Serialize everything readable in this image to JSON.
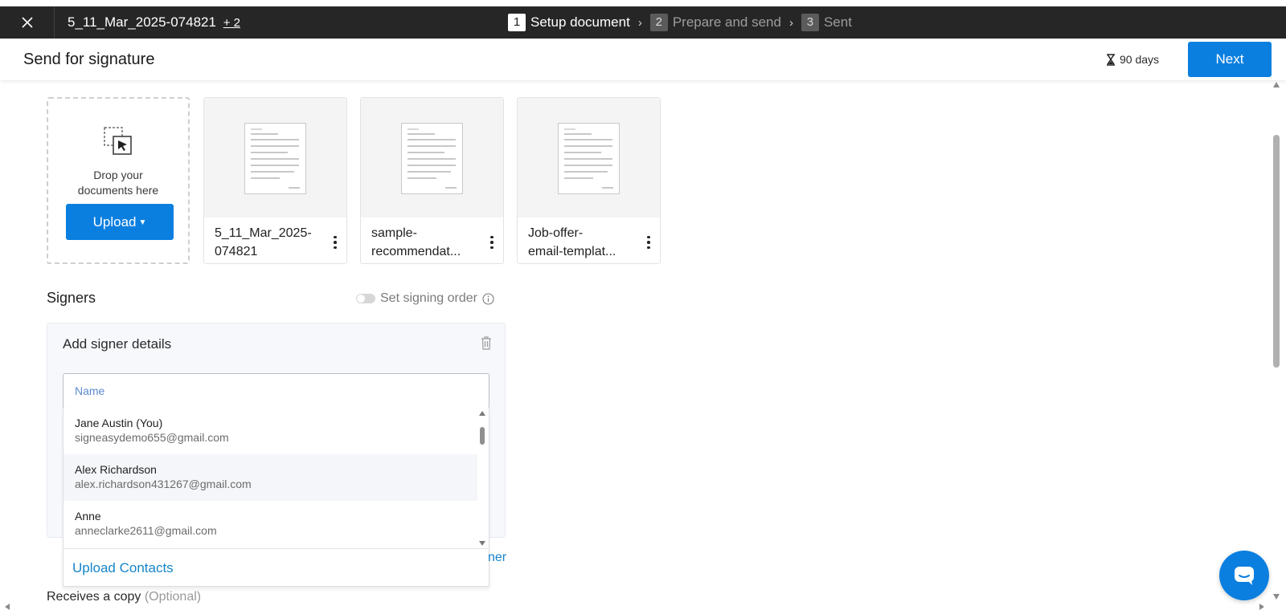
{
  "topbar": {
    "document_name": "5_11_Mar_2025-074821",
    "more_docs": "+ 2",
    "steps": [
      {
        "num": "1",
        "label": "Setup document",
        "state": "active"
      },
      {
        "num": "2",
        "label": "Prepare and send",
        "state": "inactive"
      },
      {
        "num": "3",
        "label": "Sent",
        "state": "inactive"
      }
    ],
    "icons": {
      "close": "close-icon",
      "separator": "chevron-right-icon"
    }
  },
  "header": {
    "title": "Send for signature",
    "expiry": "90 days",
    "expiry_icon": "hourglass-icon",
    "next_label": "Next"
  },
  "dropzone": {
    "text_line1": "Drop your",
    "text_line2": "documents here",
    "upload_label": "Upload",
    "icon": "drag-drop-icon"
  },
  "documents": [
    {
      "name_line1": "5_11_Mar_2025-",
      "name_line2": "074821"
    },
    {
      "name_line1": "sample-",
      "name_line2": "recommendat..."
    },
    {
      "name_line1": "Job-offer-",
      "name_line2": "email-templat..."
    }
  ],
  "signers": {
    "title": "Signers",
    "signing_order_label": "Set signing order",
    "signing_order_enabled": false,
    "card_title": "Add signer details",
    "name_placeholder": "Name",
    "name_value": "",
    "contacts": [
      {
        "name": "Jane Austin (You)",
        "email": "signeasydemo655@gmail.com",
        "highlighted": false
      },
      {
        "name": "Alex Richardson",
        "email": "alex.richardson431267@gmail.com",
        "highlighted": true
      },
      {
        "name": "Anne",
        "email": "anneclarke2611@gmail.com",
        "highlighted": false
      }
    ],
    "upload_contacts_label": "Upload Contacts",
    "add_signer_tail": "ner"
  },
  "receives_copy": {
    "label": "Receives a copy",
    "optional": "(Optional)"
  },
  "colors": {
    "accent": "#0b7fe0",
    "link": "#1585c9",
    "topbar": "#262626"
  }
}
